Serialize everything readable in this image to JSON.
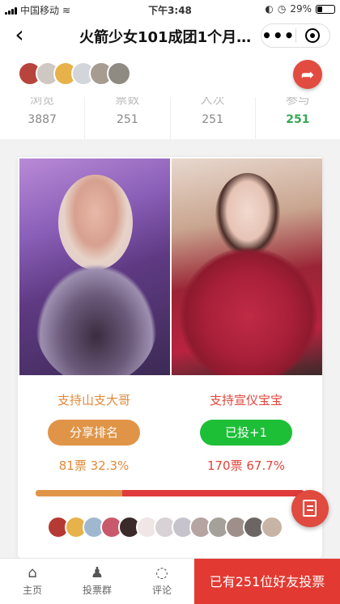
{
  "status_bar": {
    "carrier": "中国移动",
    "time": "下午3:48",
    "battery": "29%",
    "battery_level": 0.29
  },
  "nav": {
    "back_icon": "chevron-left-icon",
    "title": "火箭少女101成团1个月…",
    "more": "•••"
  },
  "stats": [
    {
      "label": "浏览",
      "value": "3887"
    },
    {
      "label": "票数",
      "value": "251"
    },
    {
      "label": "人次",
      "value": "251"
    },
    {
      "label": "参与",
      "value": "251"
    }
  ],
  "candidates": [
    {
      "name": "支持山支大哥",
      "button": "分享排名",
      "votes": "81票",
      "percent": "32.3%"
    },
    {
      "name": "支持宣仪宝宝",
      "button": "已投+1",
      "votes": "170票",
      "percent": "67.7%"
    }
  ],
  "progress": {
    "left_share": 0.323
  },
  "bottom_nav": {
    "home": "主页",
    "group": "投票群",
    "comment": "评论",
    "cta": "已有251位好友投票"
  },
  "colors": {
    "accent_red": "#e23a32",
    "orange": "#e09447",
    "green": "#1dbf37"
  }
}
